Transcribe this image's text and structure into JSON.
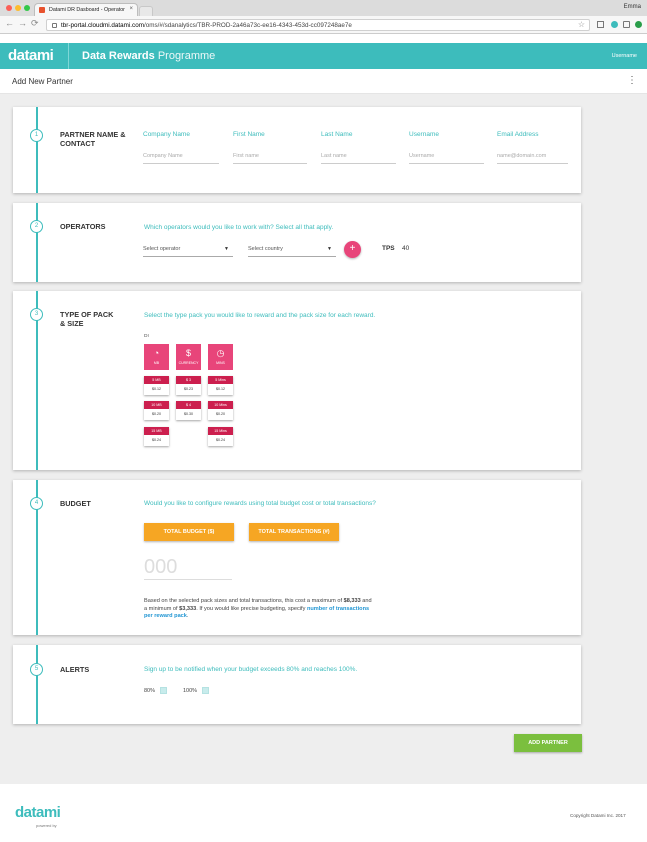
{
  "browser": {
    "tab_title": "Datami DR Dasboard - Operator",
    "tab_close": "×",
    "profile_name": "Emma",
    "url_host": "tbr-portal.cloudmi.datami.com",
    "url_path": "/oms/#/sdanalytics/TBR-PROD-2a46a73c-ee16-4343-453d-cc097248ae7e",
    "nav_back": "←",
    "nav_forward": "→",
    "nav_reload": "⟳",
    "star": "☆",
    "traffic_colors": [
      "#fc5f57",
      "#fdbc2e",
      "#34c84a"
    ]
  },
  "header": {
    "logo": "datami",
    "title_bold": "Data Rewards",
    "title_light": " Programme",
    "username": "Username"
  },
  "subheader": {
    "title": "Add New Partner",
    "menu_icon": "⋮"
  },
  "partner": {
    "step": "1",
    "title": "PARTNER NAME & CONTACT",
    "fields": [
      {
        "label": "Company Name",
        "placeholder": "Company Name"
      },
      {
        "label": "First Name",
        "placeholder": "First name"
      },
      {
        "label": "Last Name",
        "placeholder": "Last name"
      },
      {
        "label": "Username",
        "placeholder": "Username"
      },
      {
        "label": "Email Address",
        "placeholder": "name@domain.com"
      }
    ]
  },
  "operators": {
    "step": "2",
    "title": "OPERATORS",
    "question": "Which operators would you like to work with?",
    "question_hint": " Select all that apply.",
    "select_operator": "Select operator",
    "select_country": "Select country",
    "add_symbol": "+",
    "tps_label": "TPS",
    "tps_value": "40",
    "dropdown_arrow": "▼"
  },
  "pack": {
    "step": "3",
    "title": "TYPE OF PACK & SIZE",
    "question": "Select the type pack you would like to reward and the pack size for each reward.",
    "operator_code": "DI",
    "types": [
      {
        "icon": "piggy-icon",
        "glyph": "◔",
        "label": "MB"
      },
      {
        "icon": "currency-icon",
        "glyph": "$",
        "label": "CURRENCY"
      },
      {
        "icon": "clock-icon",
        "glyph": "◷",
        "label": "MINS"
      }
    ],
    "mb_options": [
      {
        "size": "5 MB",
        "price": "$0.12"
      },
      {
        "size": "10 MB",
        "price": "$0.20"
      },
      {
        "size": "15 MB",
        "price": "$0.24"
      }
    ],
    "currency_options": [
      {
        "size": "$ 3",
        "price": "$0.23"
      },
      {
        "size": "$ 4",
        "price": "$0.30"
      }
    ],
    "mins_options": [
      {
        "size": "5 Mins",
        "price": "$0.12"
      },
      {
        "size": "10 Mins",
        "price": "$0.20"
      },
      {
        "size": "15 Mins",
        "price": "$0.24"
      }
    ]
  },
  "budget": {
    "step": "4",
    "title": "BUDGET",
    "question": "Would you like to configure rewards using total budget cost or total transactions?",
    "btn_total_budget": "TOTAL BUDGET ($)",
    "btn_total_transactions": "TOTAL TRANSACTIONS (#)",
    "amount_placeholder": "000",
    "para_1": "Based on the selected pack sizes and total transactions, this cost a maximum of ",
    "max_value": "$8,333",
    "para_2": " and a minimum of ",
    "min_value": "$3,333",
    "para_3": ". If you would like precise budgeting, specify ",
    "para_link": "number of transactions per reward pack",
    "para_end": "."
  },
  "alerts": {
    "step": "5",
    "title": "ALERTS",
    "text": "Sign up to be notified when your budget exceeds 80% and reaches 100%.",
    "option_80": "80%",
    "option_100": "100%"
  },
  "actions": {
    "add_partner": "ADD PARTNER"
  },
  "footer": {
    "logo": "datami",
    "powered_by": "powered by",
    "copyright": "Copyright Datami Inc. 2017"
  },
  "colors": {
    "brand_teal": "#3dbcbc",
    "pink": "#e8457a",
    "crimson": "#cc1f4e",
    "orange": "#f6a623",
    "green": "#7bbf3e"
  }
}
